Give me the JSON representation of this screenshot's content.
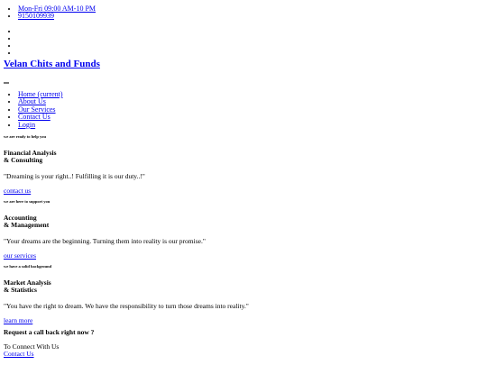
{
  "topbar": {
    "hours": "Mon-Fri 09:00 AM-10 PM",
    "phone": "9150109939",
    "social_icons": [
      "facebook-icon",
      "twitter-icon",
      "instagram-icon",
      "linkedin-icon"
    ]
  },
  "brand": {
    "name": "Velan Chits and Funds"
  },
  "nav": {
    "items": [
      {
        "label": "Home (current)"
      },
      {
        "label": "About Us"
      },
      {
        "label": "Our Services"
      },
      {
        "label": "Contact Us"
      },
      {
        "label": "Login"
      }
    ]
  },
  "slides": [
    {
      "kicker": "we are ready to help you",
      "line1": "Financial Analysis",
      "line2": "& Consulting",
      "quote": "\"Dreaming is your right..! Fulfilling it is our duty..!\"",
      "cta": "contact us"
    },
    {
      "kicker": "we are here to support you",
      "line1": "Accounting",
      "line2": "& Management",
      "quote": "\"Your dreams are the beginning. Turning them into reality is our promise.\"",
      "cta": "our services"
    },
    {
      "kicker": "we have a solid background",
      "line1": "Market Analysis",
      "line2": "& Statistics",
      "quote": "\"You have the right to dream. We have the responsibility to turn those dreams into reality.\"",
      "cta": "learn more"
    }
  ],
  "callback": {
    "title": "Request a call back right now ?",
    "subtitle": "To Connect With Us",
    "link": "Contact Us"
  }
}
